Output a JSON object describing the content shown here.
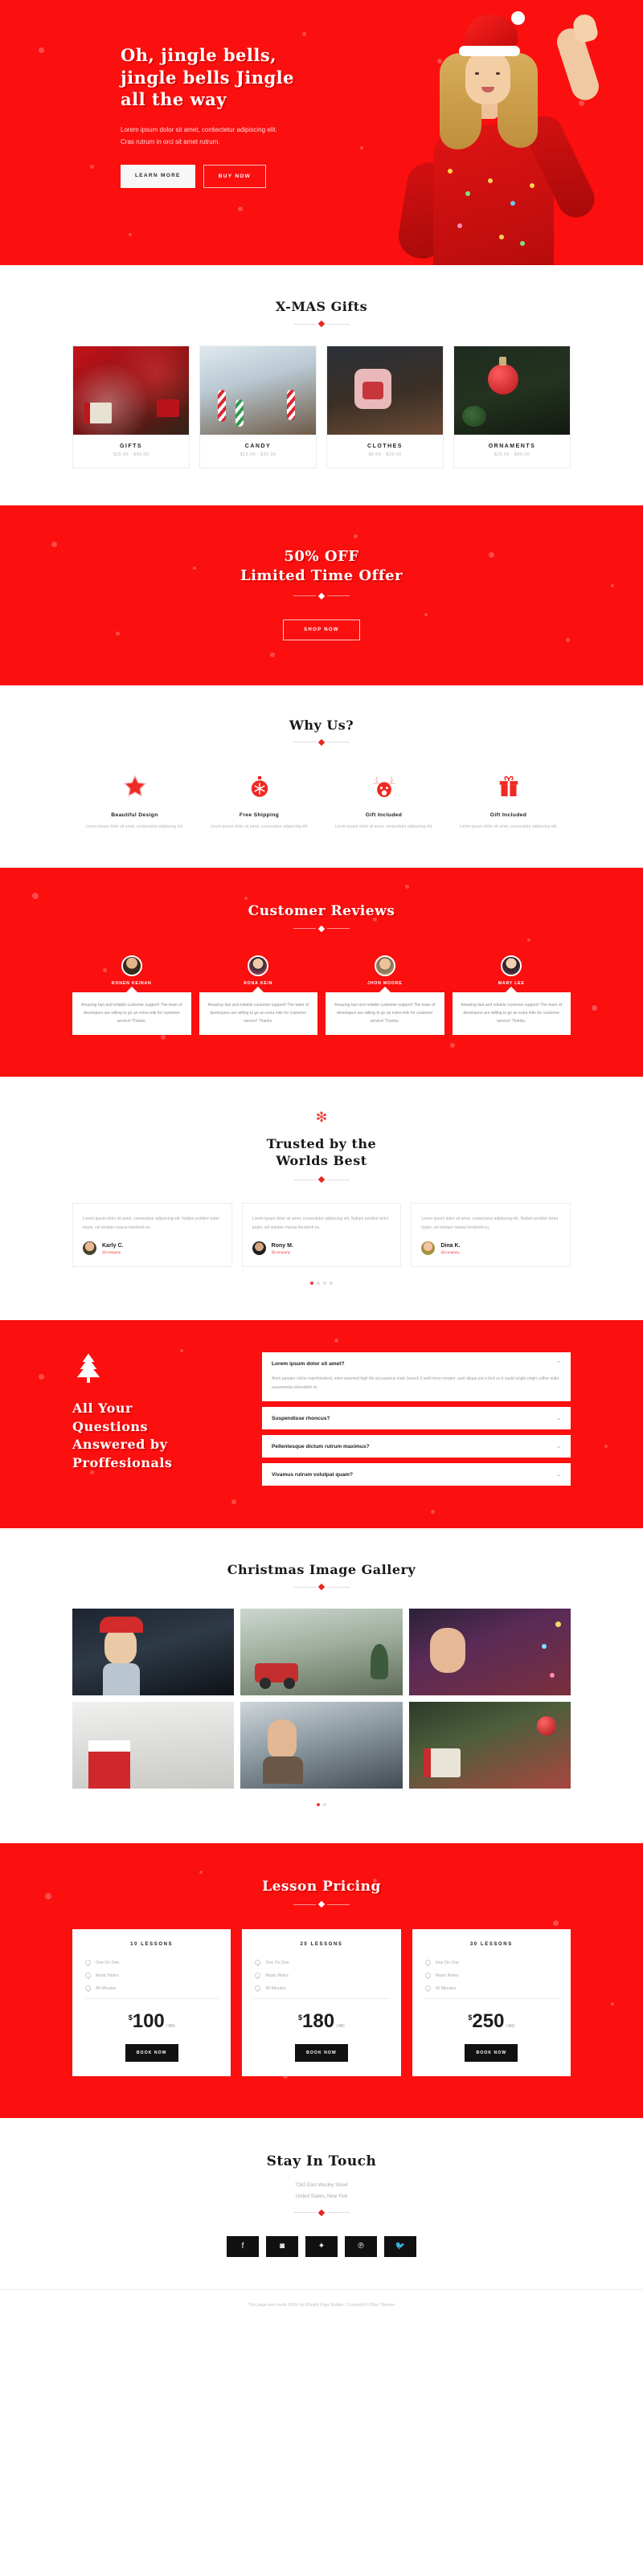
{
  "theme": {
    "red": "#fb0f0f",
    "dark": "#16181a",
    "accent": "#ef3b36"
  },
  "hero": {
    "title_line1": "Oh, jingle bells,",
    "title_line2": "jingle bells Jingle",
    "title_line3": "all the way",
    "paragraph_line1": "Lorem ipsum dolor sit amet, consectetur adipiscing elit.",
    "paragraph_line2": "Cras rutrum in orci sit amet rutrum.",
    "btn_primary": "LEARN MORE",
    "btn_secondary": "BUY NOW"
  },
  "gifts": {
    "title": "X-MAS Gifts",
    "items": [
      {
        "name": "GIFTS",
        "price": "$25.00 - $40.00"
      },
      {
        "name": "CANDY",
        "price": "$15.00 - $35.00"
      },
      {
        "name": "CLOTHES",
        "price": "$5.00 - $25.00"
      },
      {
        "name": "ORNAMENTS",
        "price": "$25.00 - $90.00"
      }
    ]
  },
  "offer": {
    "line1": "50% OFF",
    "line2": "Limited Time Offer",
    "button": "SHOP NOW"
  },
  "why": {
    "title": "Why Us?",
    "items": [
      {
        "icon": "star-icon",
        "label": "Beautiful Design",
        "text": "Lorem ipsum dolor sit amet, consectetur adipiscing elit."
      },
      {
        "icon": "ornament-icon",
        "label": "Free Shipping",
        "text": "Lorem ipsum dolor sit amet, consectetur adipiscing elit."
      },
      {
        "icon": "reindeer-icon",
        "label": "Gift Included",
        "text": "Lorem ipsum dolor sit amet, consectetur adipiscing elit."
      },
      {
        "icon": "giftbox-icon",
        "label": "Gift Included",
        "text": "Lorem ipsum dolor sit amet, consectetur adipiscing elit."
      }
    ]
  },
  "reviews": {
    "title": "Customer Reviews",
    "items": [
      {
        "name": "RONEN KEINAN",
        "text": "Amazing fast and reliable customer support! The team of developers are willing to go an extra mile for customer service! Thanks."
      },
      {
        "name": "RONA KEIN",
        "text": "Amazing fast and reliable customer support! The team of developers are willing to go an extra mile for customer service! Thanks."
      },
      {
        "name": "JHON MOORE",
        "text": "Amazing fast and reliable customer support! The team of developers are willing to go an extra mile for customer service! Thanks."
      },
      {
        "name": "MARY LEE",
        "text": "Amazing fast and reliable customer support! The team of developers are willing to go an extra mile for customer service! Thanks."
      }
    ]
  },
  "trusted": {
    "flake": "❇",
    "title_line1": "Trusted by the",
    "title_line2": "Worlds Best",
    "cards": [
      {
        "text": "Lorem ipsum dolor sit amet, consectetur adipiscing elit. Nullam porttitor tortor turpis, vel semper massa hendrerit eu.",
        "name": "Karly C.",
        "company": "@company"
      },
      {
        "text": "Lorem ipsum dolor sit amet, consectetur adipiscing elit. Nullam porttitor tortor turpis, vel semper massa hendrerit eu.",
        "name": "Rony M.",
        "company": "@company"
      },
      {
        "text": "Lorem ipsum dolor sit amet, consectetur adipiscing elit. Nullam porttitor tortor turpis, vel semper massa hendrerit eu.",
        "name": "Dina K.",
        "company": "@company"
      }
    ],
    "pagination": 4,
    "active_dot": 1
  },
  "faq": {
    "heading_line1": "All Your",
    "heading_line2": "Questions",
    "heading_line3": "Answered by",
    "heading_line4": "Proffesionals",
    "items": [
      {
        "question": "Lorem ipsum dolor sit amet?",
        "open": true,
        "chevron": "⌃",
        "answer": "Anim pariatur cliche reprehenderit, enim eiusmod high life accusamus mod. brunch 3 wolf moon tempor, sunt aliqua put a bird on it squid single-origin coffee nulla assumenda shoreditch et."
      },
      {
        "question": "Suspendisse rhoncus?",
        "open": false,
        "chevron": "⌄",
        "answer": ""
      },
      {
        "question": "Pellentesque dictum rutrum maximus?",
        "open": false,
        "chevron": "⌄",
        "answer": ""
      },
      {
        "question": "Vivamus rutrum volutpat quam?",
        "open": false,
        "chevron": "⌄",
        "answer": ""
      }
    ]
  },
  "gallery": {
    "title": "Christmas Image Gallery",
    "cells": 6,
    "active_dot": 1,
    "dots": 2
  },
  "pricing": {
    "title": "Lesson Pricing",
    "plans": [
      {
        "title": "10 LESSONS",
        "features": [
          "One On One",
          "Music Notes",
          "45 Minutes"
        ],
        "currency": "$",
        "price": "100",
        "period": "/ MO",
        "button": "BOOK NOW"
      },
      {
        "title": "20 LESSONS",
        "features": [
          "One On One",
          "Music Notes",
          "45 Minutes"
        ],
        "currency": "$",
        "price": "180",
        "period": "/ MO",
        "button": "BOOK NOW"
      },
      {
        "title": "30 LESSONS",
        "features": [
          "One On One",
          "Music Notes",
          "45 Minutes"
        ],
        "currency": "$",
        "price": "250",
        "period": "/ MO",
        "button": "BOOK NOW"
      }
    ]
  },
  "touch": {
    "title": "Stay In Touch",
    "address_line1": "7262 East Wesley Street",
    "address_line2": "United States, New York",
    "socials": [
      {
        "icon": "facebook-icon",
        "glyph": "f"
      },
      {
        "icon": "instagram-icon",
        "glyph": "◙"
      },
      {
        "icon": "yelp-icon",
        "glyph": "✦"
      },
      {
        "icon": "pinterest-icon",
        "glyph": "℗"
      },
      {
        "icon": "twitter-icon",
        "glyph": "🐦"
      }
    ],
    "copyright": "This page was made 100% by Elfsight Page Builder | Copyright © Blox Themes"
  }
}
